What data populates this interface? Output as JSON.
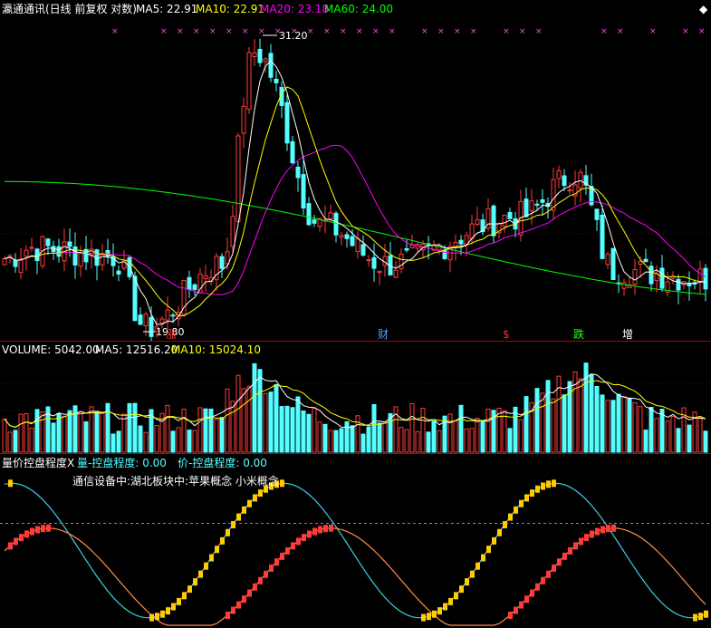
{
  "header": {
    "title": "瀛通通讯(日线 前复权 对数)",
    "ma5": "MA5: 22.91",
    "ma10": "MA10: 22.91",
    "ma20": "MA20: 23.18",
    "ma60": "MA60: 24.00"
  },
  "price_annotations": {
    "high": "31.20",
    "low": "19.80"
  },
  "event_markers": [
    {
      "label": "涨",
      "color": "#ff3b3b",
      "x": 30
    },
    {
      "label": "财",
      "color": "#4aa3ff",
      "x": 69
    },
    {
      "label": "$",
      "color": "#ff2a2a",
      "x": 92
    },
    {
      "label": "跌",
      "color": "#22ff22",
      "x": 105
    },
    {
      "label": "增",
      "color": "#ffffff",
      "x": 114
    }
  ],
  "volume_header": {
    "label": "VOLUME: 5042.00",
    "ma5": "MA5: 12516.20",
    "ma10": "MA10: 15024.10"
  },
  "indicator_header": {
    "name": "量价控盘程度X",
    "vol": "量-控盘程度: 0.00",
    "price": "价-控盘程度: 0.00"
  },
  "sector_text": "通信设备中:湖北板块中:苹果概念 小米概念",
  "colors": {
    "up": "#ff3b3b",
    "down": "#54ffff",
    "ma5": "#ffffff",
    "ma10": "#ffff00",
    "ma20": "#ff00ff",
    "ma60": "#00ff00",
    "axis": "#b00000",
    "vol_bar_yellow": "#ffcc00",
    "ind_line_cyan": "#3ad0e0",
    "ind_line_orange": "#ff8a4a"
  },
  "chart_data": [
    {
      "type": "candlestick",
      "x_count": 130,
      "ylim": [
        19.5,
        32.5
      ],
      "scale": "log",
      "points": [
        {
          "x": 5,
          "y": 22.6,
          "dir": "up"
        },
        {
          "x": 20,
          "y": 22.3,
          "dir": "down"
        },
        {
          "x": 26,
          "y": 19.8,
          "dir": "down"
        },
        {
          "x": 40,
          "y": 22.0,
          "dir": "up"
        },
        {
          "x": 46,
          "y": 31.2,
          "dir": "up"
        },
        {
          "x": 58,
          "y": 23.5,
          "dir": "down"
        },
        {
          "x": 70,
          "y": 22.0,
          "dir": "down"
        },
        {
          "x": 95,
          "y": 23.8,
          "dir": "up"
        },
        {
          "x": 105,
          "y": 25.5,
          "dir": "up"
        },
        {
          "x": 112,
          "y": 21.8,
          "dir": "down"
        },
        {
          "x": 128,
          "y": 21.5,
          "dir": "up"
        }
      ],
      "series": [
        {
          "name": "MA5",
          "values": [
            22.9
          ]
        },
        {
          "name": "MA10",
          "values": [
            22.9
          ]
        },
        {
          "name": "MA20",
          "values": [
            23.2
          ]
        },
        {
          "name": "MA60",
          "values": [
            24.0
          ]
        }
      ]
    },
    {
      "type": "bar",
      "series": [
        {
          "name": "VOLUME",
          "values": [
            5042
          ]
        },
        {
          "name": "MA5",
          "values": [
            12516.2
          ]
        },
        {
          "name": "MA10",
          "values": [
            15024.1
          ]
        }
      ]
    },
    {
      "type": "line",
      "series": [
        {
          "name": "量-控盘程度",
          "values": [
            0.0
          ]
        },
        {
          "name": "价-控盘程度",
          "values": [
            0.0
          ]
        }
      ]
    }
  ]
}
